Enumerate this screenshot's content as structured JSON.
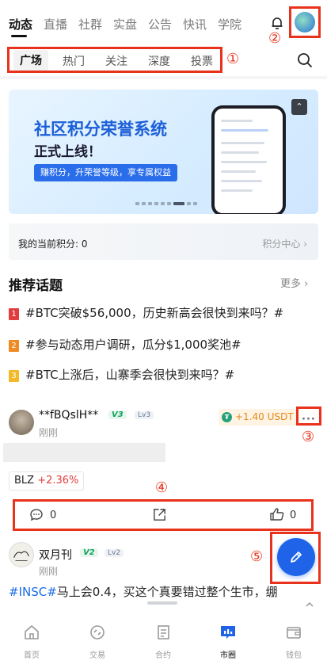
{
  "top_nav": {
    "tabs": [
      "动态",
      "直播",
      "社群",
      "实盘",
      "公告",
      "快讯",
      "学院"
    ],
    "active_index": 0
  },
  "sub_nav": {
    "tabs": [
      "广场",
      "热门",
      "关注",
      "深度",
      "投票"
    ],
    "active_index": 0
  },
  "annotations": [
    "①",
    "②",
    "③",
    "④",
    "⑤"
  ],
  "banner": {
    "title": "社区积分荣誉系统",
    "subtitle": "正式上线！",
    "pill": "赚积分，升荣誉等级，享专属权益"
  },
  "points": {
    "label": "我的当前积分: 0",
    "link": "积分中心"
  },
  "topics": {
    "title": "推荐话题",
    "more": "更多",
    "items": [
      {
        "rank": "1",
        "text": "#BTC突破$56,000，历史新高会很快到来吗？#",
        "color": "#e23c3c"
      },
      {
        "rank": "2",
        "text": "#参与动态用户调研，瓜分$1,000奖池#",
        "color": "#f08a24"
      },
      {
        "rank": "3",
        "text": "#BTC上涨后，山寨季会很快到来吗？#",
        "color": "#f2b92a"
      }
    ]
  },
  "post1": {
    "username": "**fBQslH**",
    "v_badge": "V3",
    "lv_badge": "Lv3",
    "time": "刚刚",
    "reward": "+1.40 USDT",
    "coin_symbol": "BLZ",
    "coin_change": "+2.36%",
    "comments": "0",
    "likes": "0"
  },
  "post2": {
    "username": "双月刊",
    "v_badge": "V2",
    "lv_badge": "Lv2",
    "time": "刚刚",
    "hashtag": "#INSC#",
    "text": "马上会0.4，买这个真要错过整个生市，绷"
  },
  "bottom_nav": {
    "items": [
      "首页",
      "交易",
      "合约",
      "市圈",
      "钱包"
    ],
    "active_index": 3
  },
  "colors": {
    "annotation": "#e8321b",
    "accent": "#1f64e8",
    "positive": "#12a15d",
    "price_up": "#e23c3c"
  }
}
